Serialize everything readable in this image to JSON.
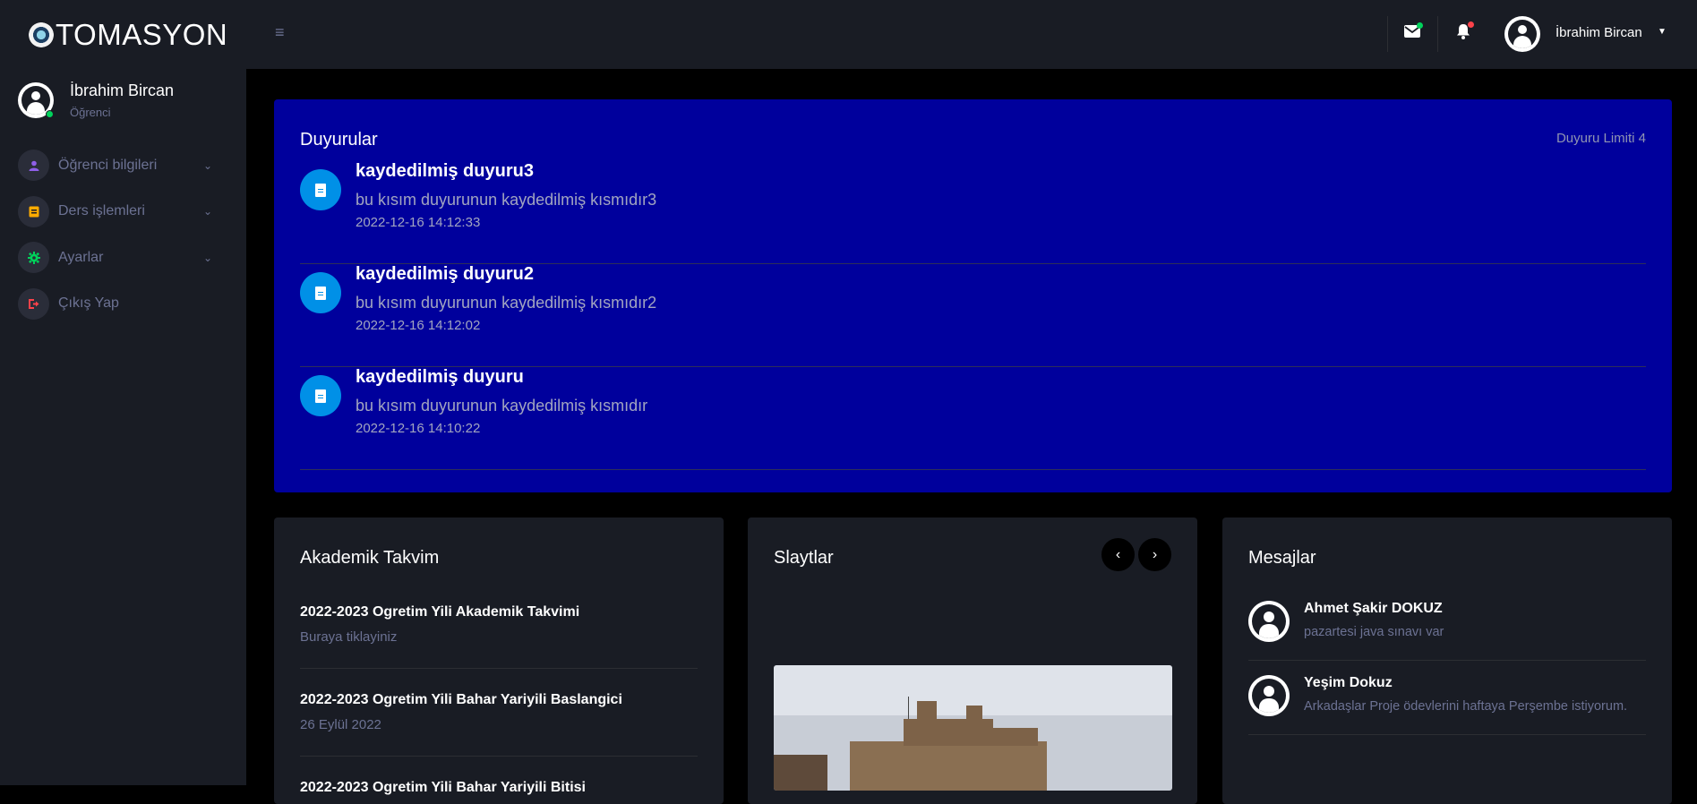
{
  "brand": {
    "name": "TOMASYON"
  },
  "profile": {
    "name": "İbrahim Bircan",
    "role": "Öğrenci"
  },
  "sidebar": {
    "items": [
      {
        "label": "Öğrenci bilgileri",
        "icon": "account-icon",
        "color": "#8f5fe8"
      },
      {
        "label": "Ders işlemleri",
        "icon": "book-icon",
        "color": "#ffab00"
      },
      {
        "label": "Ayarlar",
        "icon": "gear-icon",
        "color": "#00d25b"
      },
      {
        "label": "Çıkış Yap",
        "icon": "logout-icon",
        "color": "#fc424a"
      }
    ]
  },
  "topbar": {
    "user_name": "İbrahim Bircan"
  },
  "announcements": {
    "title": "Duyurular",
    "limit_label": "Duyuru Limiti 4",
    "items": [
      {
        "title": "kaydedilmiş duyuru3",
        "text": "bu kısım duyurunun kaydedilmiş kısmıdır3",
        "date": "2022-12-16 14:12:33"
      },
      {
        "title": "kaydedilmiş duyuru2",
        "text": "bu kısım duyurunun kaydedilmiş kısmıdır2",
        "date": "2022-12-16 14:12:02"
      },
      {
        "title": "kaydedilmiş duyuru",
        "text": "bu kısım duyurunun kaydedilmiş kısmıdır",
        "date": "2022-12-16 14:10:22"
      }
    ]
  },
  "calendar": {
    "title": "Akademik Takvim",
    "items": [
      {
        "title": "2022-2023 Ogretim Yili Akademik Takvimi",
        "sub": "Buraya tiklayiniz"
      },
      {
        "title": "2022-2023 Ogretim Yili Bahar Yariyili Baslangici",
        "sub": "26 Eylül 2022"
      },
      {
        "title": "2022-2023 Ogretim Yili Bahar Yariyili Bitisi",
        "sub": ""
      }
    ]
  },
  "slides": {
    "title": "Slaytlar"
  },
  "messages": {
    "title": "Mesajlar",
    "items": [
      {
        "name": "Ahmet Şakir DOKUZ",
        "text": "pazartesi java sınavı var"
      },
      {
        "name": "Yeşim Dokuz",
        "text": "Arkadaşlar Proje ödevlerini haftaya Perşembe istiyorum."
      }
    ]
  },
  "colors": {
    "sidebar_bg": "#191c24",
    "announcement_bg": "#00009c",
    "accent_blue": "#0090e7",
    "success": "#00d25b",
    "danger": "#fc424a"
  }
}
